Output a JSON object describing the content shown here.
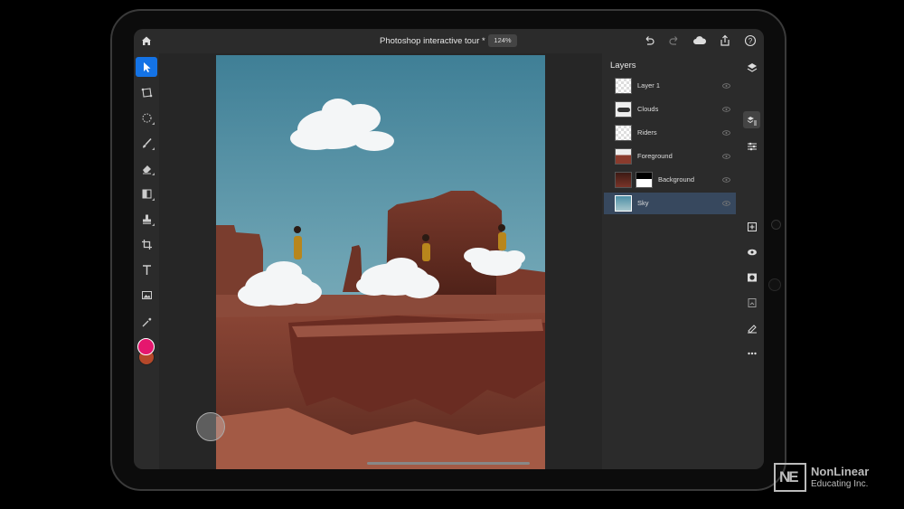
{
  "topbar": {
    "title": "Photoshop interactive tour *",
    "zoom": "124%",
    "icons": [
      "home-icon",
      "undo-icon",
      "redo-icon",
      "cloud-icon",
      "share-icon",
      "help-icon"
    ]
  },
  "tools": [
    "move-tool",
    "transform-tool",
    "selection-tool",
    "brush-tool",
    "eraser-tool",
    "gradient-tool",
    "clone-stamp-tool",
    "crop-tool",
    "type-tool",
    "place-image-tool",
    "eyedropper-tool"
  ],
  "colors": {
    "foreground": "#e5176e",
    "background": "#b5482a",
    "accent": "#1473e6"
  },
  "layers": {
    "title": "Layers",
    "items": [
      {
        "name": "Layer 1",
        "thumb": "transparent"
      },
      {
        "name": "Clouds",
        "thumb": "clouds"
      },
      {
        "name": "Riders",
        "thumb": "riders"
      },
      {
        "name": "Foreground",
        "thumb": "foreground"
      },
      {
        "name": "Background",
        "thumb": "background",
        "mask": true
      },
      {
        "name": "Sky",
        "thumb": "sky",
        "selected": true
      }
    ]
  },
  "right_icons": [
    "layers-icon",
    "layer-properties-icon",
    "adjustments-icon",
    "add-layer-icon",
    "visibility-icon",
    "mask-icon",
    "clip-icon",
    "fx-icon",
    "more-icon"
  ],
  "watermark": {
    "line1": "NonLinear",
    "line2": "Educating Inc.",
    "logo": "NE"
  }
}
